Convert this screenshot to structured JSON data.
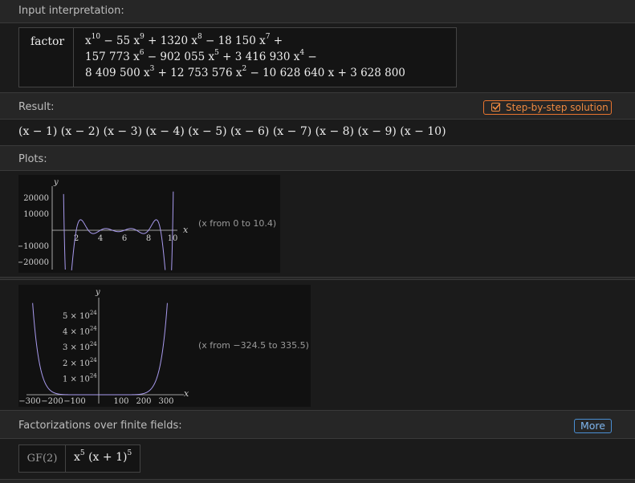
{
  "pods": {
    "input": {
      "title": "Input interpretation:",
      "function": "factor",
      "poly_lines": [
        [
          {
            "t": "x"
          },
          {
            "s": "10"
          },
          {
            "t": " − 55 x"
          },
          {
            "s": "9"
          },
          {
            "t": " + 1320 x"
          },
          {
            "s": "8"
          },
          {
            "t": " − 18 150 x"
          },
          {
            "s": "7"
          },
          {
            "t": " +"
          }
        ],
        [
          {
            "t": "157 773 x"
          },
          {
            "s": "6"
          },
          {
            "t": " − 902 055 x"
          },
          {
            "s": "5"
          },
          {
            "t": " + 3 416 930 x"
          },
          {
            "s": "4"
          },
          {
            "t": " −"
          }
        ],
        [
          {
            "t": "8 409 500 x"
          },
          {
            "s": "3"
          },
          {
            "t": " + 12 753 576 x"
          },
          {
            "s": "2"
          },
          {
            "t": " − 10 628 640 x + 3 628 800"
          }
        ]
      ]
    },
    "result": {
      "title": "Result:",
      "step_label": "Step-by-step solution",
      "text": "(x − 1) (x − 2) (x − 3) (x − 4) (x − 5) (x − 6) (x − 7) (x − 8) (x − 9) (x − 10)"
    },
    "plots": {
      "title": "Plots:",
      "plot1": {
        "range_text": "(x from 0 to 10.4)",
        "xlabel": "x",
        "ylabel": "y",
        "xticks": [
          "2",
          "4",
          "6",
          "8",
          "10"
        ],
        "yticks": [
          "20000",
          "10000",
          "−10000",
          "−20000"
        ]
      },
      "plot2": {
        "range_text": "(x from −324.5 to 335.5)",
        "xlabel": "x",
        "ylabel": "y",
        "xticks": [
          "−300",
          "−200",
          "−100",
          "100",
          "200",
          "300"
        ],
        "yticks": [
          "5 × 10",
          "4 × 10",
          "3 × 10",
          "2 × 10",
          "1 × 10"
        ],
        "ytick_exp": "24"
      }
    },
    "finite_fields": {
      "title": "Factorizations over finite fields:",
      "more_label": "More",
      "field": "GF(2)",
      "value": [
        {
          "t": "x"
        },
        {
          "s": "5"
        },
        {
          "t": " (x + 1)"
        },
        {
          "s": "5"
        }
      ]
    }
  },
  "colors": {
    "curve": "#a99bef",
    "accent_orange": "#e8742e",
    "accent_blue": "#4a8fd4"
  }
}
